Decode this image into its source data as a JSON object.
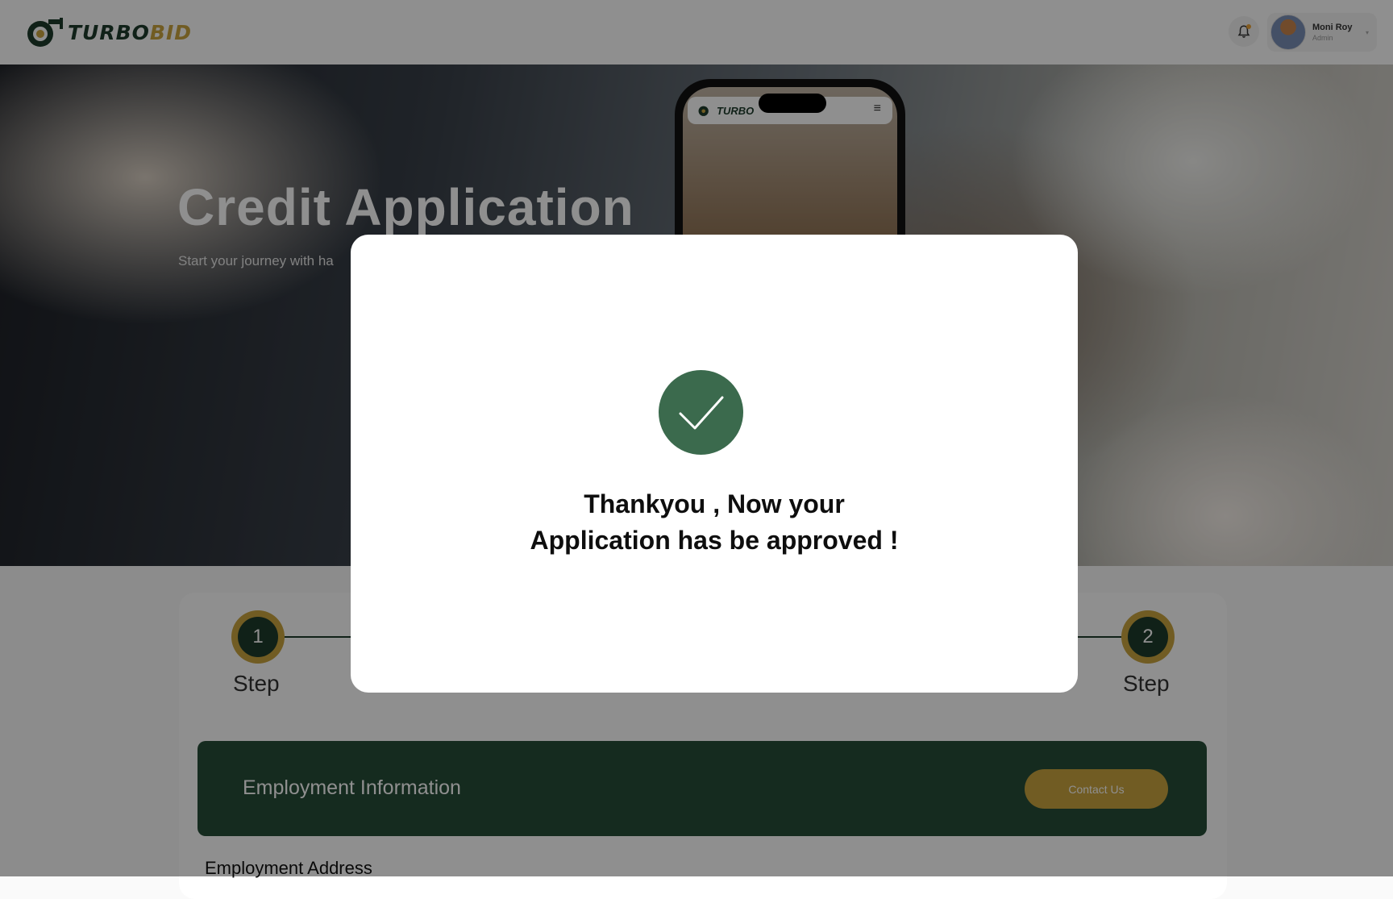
{
  "header": {
    "brand_part1": "TURBO",
    "brand_part2": "BID",
    "user_name": "Moni Roy",
    "user_role": "Admin",
    "icons": [
      "logo-icon",
      "bell-icon",
      "chevron-down-icon"
    ]
  },
  "hero": {
    "title": "Credit Application",
    "subtitle": "Start your journey with ha",
    "phone_brand": "TURBO",
    "phone_menu_glyph": "≡"
  },
  "stepper": {
    "steps": [
      {
        "number": "1",
        "label": "Step"
      },
      {
        "number": "2",
        "label": "Step"
      }
    ]
  },
  "employment": {
    "section_title": "Employment Information",
    "contact_label": "Contact Us",
    "address_heading": "Employment Address"
  },
  "modal": {
    "line1": "Thankyou , Now your",
    "line2": "Application has be approved !",
    "icon": "checkmark-icon"
  },
  "colors": {
    "brand_green": "#1d3b2c",
    "brand_gold": "#c9a43f",
    "success_green": "#3b6a4d"
  }
}
